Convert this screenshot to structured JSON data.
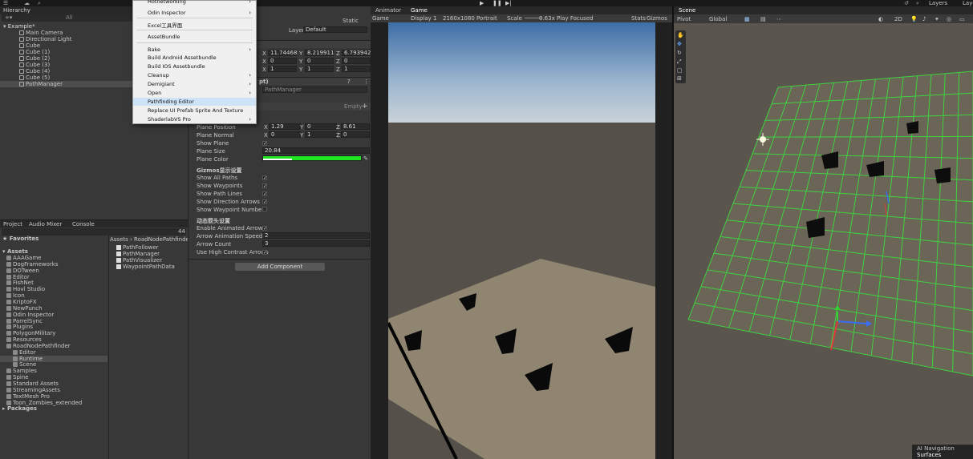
{
  "toolbar": {
    "layers": "Layers",
    "layout": "Layo"
  },
  "hierarchy": {
    "tab": "Hierarchy",
    "search_placeholder": "All",
    "scene": "Example*",
    "items": [
      "Main Camera",
      "Directional Light",
      "Cube",
      "Cube (1)",
      "Cube (2)",
      "Cube (3)",
      "Cube (4)",
      "Cube (5)",
      "PathManager"
    ]
  },
  "context_menu": {
    "items": [
      {
        "label": "Hotnetworking",
        "submenu": true
      },
      {
        "label": "Odin Inspector",
        "submenu": true
      },
      {
        "label": "Excel工具界面",
        "submenu": false
      },
      {
        "label": "AssetBundle",
        "submenu": false
      },
      {
        "label": "Bake",
        "submenu": true
      },
      {
        "label": "Build Android Assetbundle",
        "submenu": false
      },
      {
        "label": "Build IOS Assetbundle",
        "submenu": false
      },
      {
        "label": "Cleanup",
        "submenu": true
      },
      {
        "label": "Demigiant",
        "submenu": true
      },
      {
        "label": "Open",
        "submenu": true
      },
      {
        "label": "Pathfinding Editor",
        "submenu": false
      },
      {
        "label": "Replace UI Prefab Sprite And Texture",
        "submenu": false
      },
      {
        "label": "ShaderlabVS Pro",
        "submenu": true
      }
    ]
  },
  "inspector": {
    "static_label": "Static",
    "layer_label": "Layer",
    "layer_value": "Default",
    "transform": {
      "pos": {
        "x": "11.74468",
        "y": "8.219911",
        "z": "6.793942"
      },
      "rot": {
        "x": "0",
        "y": "0",
        "z": "0"
      },
      "scale": {
        "x": "1",
        "y": "1",
        "z": "1"
      }
    },
    "script_header": "pt)",
    "script_ref": "PathManager",
    "empty_label": "Empty",
    "plane_position": {
      "label": "Plane Position",
      "x": "1.29",
      "y": "0",
      "z": "8.61"
    },
    "plane_normal": {
      "label": "Plane Normal",
      "x": "0",
      "y": "1",
      "z": "0"
    },
    "show_plane": "Show Plane",
    "plane_size": {
      "label": "Plane Size",
      "value": "20.84"
    },
    "plane_color": {
      "label": "Plane Color",
      "color": "#1fe61f"
    },
    "gizmos_header": "Gizmos显示设置",
    "gizmo_opts": [
      {
        "label": "Show All Paths",
        "checked": true
      },
      {
        "label": "Show Waypoints",
        "checked": true
      },
      {
        "label": "Show Path Lines",
        "checked": true
      },
      {
        "label": "Show Direction Arrows",
        "checked": true
      },
      {
        "label": "Show Waypoint Numbers",
        "checked": false
      }
    ],
    "anim_header": "动态箭头设置",
    "enable_arrows": {
      "label": "Enable Animated Arrows",
      "checked": true
    },
    "arrow_speed": {
      "label": "Arrow Animation Speed",
      "value": "2"
    },
    "arrow_count": {
      "label": "Arrow Count",
      "value": "3"
    },
    "high_contrast": {
      "label": "Use High Contrast Arrows",
      "checked": true
    },
    "add_component": "Add Component"
  },
  "project": {
    "tabs": [
      "Project",
      "Audio Mixer",
      "Console"
    ],
    "count": "44",
    "favorites": "Favorites",
    "assets": "Assets",
    "folders": [
      "AAAGame",
      "DogFrameworks",
      "DOTween",
      "Editor",
      "FishNet",
      "Hovl Studio",
      "Icon",
      "KriptoFX",
      "NewPunch",
      "Odin Inspector",
      "ParrelSync",
      "Plugins",
      "PolygonMilitary",
      "Resources",
      "RoadNodePathfinder",
      "Editor",
      "Runtime",
      "Scene",
      "Samples",
      "Spine",
      "Standard Assets",
      "StreamingAssets",
      "TextMesh Pro",
      "Toon_Zombies_extended"
    ],
    "packages": "Packages",
    "breadcrumb": [
      "Assets",
      "RoadNodePathfinder",
      "R"
    ],
    "files": [
      "PathFollower",
      "PathManager",
      "PathVisualizer",
      "WaypointPathData"
    ]
  },
  "game": {
    "tabs": [
      "Animator",
      "Game"
    ],
    "mode": "Game",
    "display": "Display 1",
    "resolution": "2160x1080 Portrait",
    "scale_label": "Scale",
    "scale_value": "0.63x",
    "play_focused": "Play Focused",
    "stats": "Stats",
    "gizmos": "Gizmos"
  },
  "scene": {
    "tab": "Scene",
    "pivot": "Pivot",
    "global": "Global",
    "mode_2d": "2D",
    "overlay": [
      "AI Navigation",
      "Surfaces"
    ]
  }
}
